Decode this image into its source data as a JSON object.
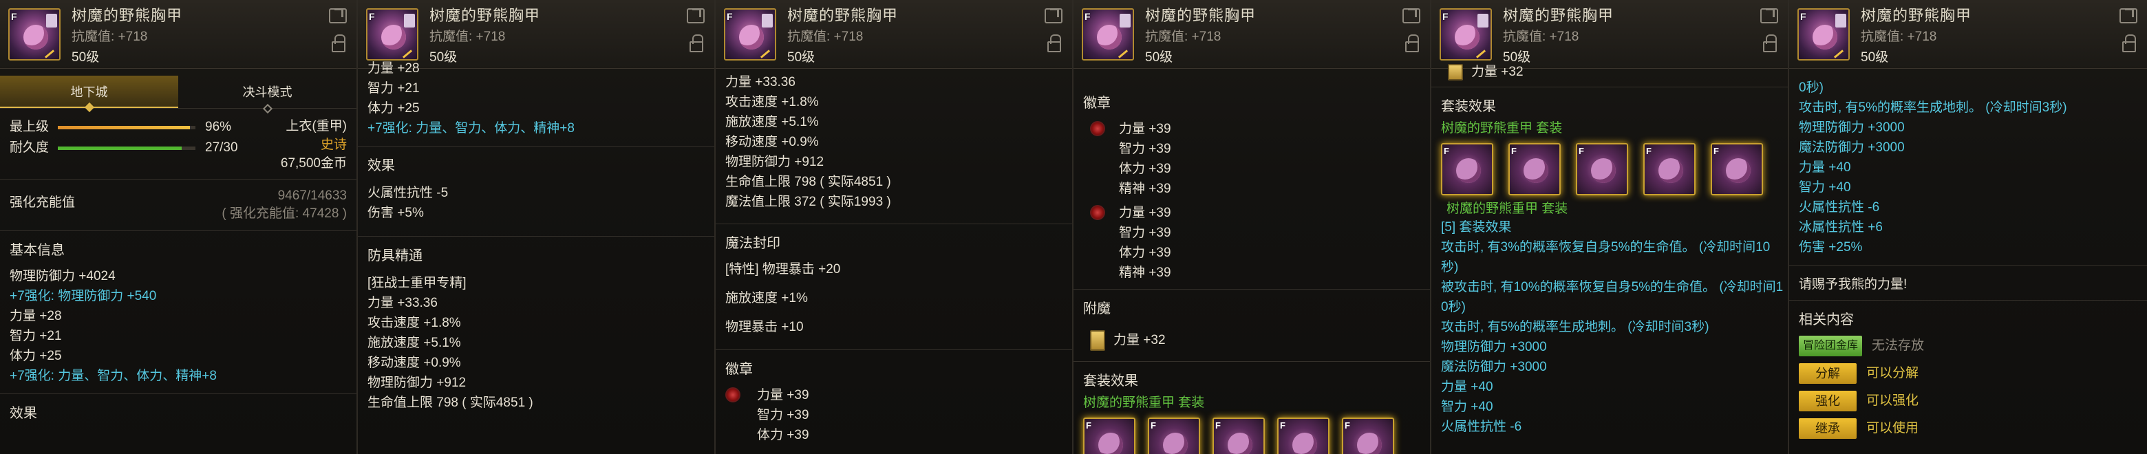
{
  "item": {
    "name": "树魔的野熊胸甲",
    "resist": "抗魔值: +718",
    "level": "50级"
  },
  "p1": {
    "tabs": [
      "地下城",
      "决斗模式"
    ],
    "grade_label": "最上级",
    "grade_pct": "96%",
    "grade_frac": 0.96,
    "dur_label": "耐久度",
    "dur_val": "27/30",
    "dur_frac": 0.9,
    "slot": "上衣(重甲)",
    "rarity": "史诗",
    "price": "67,500金币",
    "charge_title": "强化充能值",
    "charge_val": "9467/14633",
    "charge_detail": "( 强化充能值: 47428 )",
    "basic_title": "基本信息",
    "lines": [
      "物理防御力 +4024",
      "+7强化: 物理防御力 +540",
      "力量 +28",
      "智力 +21",
      "体力 +25",
      "+7强化: 力量、智力、体力、精神+8"
    ],
    "effect_title": "效果"
  },
  "p2": {
    "top": [
      "力量 +28",
      "智力 +21",
      "体力 +25",
      "+7强化: 力量、智力、体力、精神+8"
    ],
    "effect_title": "效果",
    "effects": [
      "火属性抗性 -5",
      "伤害 +5%"
    ],
    "refine_title": "防具精通",
    "refine_sub": "[狂战士重甲专精]",
    "refine": [
      "力量 +33.36",
      "攻击速度 +1.8%",
      "施放速度 +5.1%",
      "移动速度 +0.9%",
      "物理防御力 +912",
      "生命值上限 798 ( 实际4851 )"
    ]
  },
  "p3": {
    "top": [
      "力量 +33.36",
      "攻击速度 +1.8%",
      "施放速度 +5.1%",
      "移动速度 +0.9%",
      "物理防御力 +912",
      "生命值上限 798 ( 实际4851 )",
      "魔法值上限 372 ( 实际1993 )"
    ],
    "seal_title": "魔法封印",
    "seal": [
      "[特性] 物理暴击 +20",
      "施放速度 +1%",
      "物理暴击 +10"
    ],
    "emblem_title": "徽章",
    "emblem": [
      "力量 +39",
      "智力 +39",
      "体力 +39"
    ]
  },
  "p4": {
    "emblem_title": "徽章",
    "emblem1": [
      "力量 +39",
      "智力 +39",
      "体力 +39",
      "精神 +39"
    ],
    "emblem2": [
      "力量 +39",
      "智力 +39",
      "体力 +39",
      "精神 +39"
    ],
    "enchant_title": "附魔",
    "enchant": "力量 +32",
    "set_title": "套装效果",
    "set_name": "树魔的野熊重甲 套装"
  },
  "p5": {
    "top": "力量 +32",
    "set_title": "套装效果",
    "set_name": "树魔的野熊重甲 套装",
    "set_name2": "树魔的野熊重甲 套装",
    "set_count": "[5] 套装效果",
    "lines": [
      "攻击时, 有3%的概率恢复自身5%的生命值。 (冷却时间10",
      "秒)",
      "被攻击时, 有10%的概率恢复自身5%的生命值。 (冷却时间1",
      "0秒)",
      "攻击时, 有5%的概率生成地刺。 (冷却时间3秒)",
      "物理防御力 +3000",
      "魔法防御力 +3000",
      "力量 +40",
      "智力 +40",
      "火属性抗性 -6"
    ]
  },
  "p6": {
    "lines": [
      "0秒)",
      "攻击时, 有5%的概率生成地刺。 (冷却时间3秒)",
      "物理防御力 +3000",
      "魔法防御力 +3000",
      "力量 +40",
      "智力 +40",
      "火属性抗性 -6",
      "冰属性抗性 +6",
      "伤害 +25%"
    ],
    "quote": "请赐予我熊的力量!",
    "related_title": "相关内容",
    "actions": [
      {
        "btn": "冒险团金库",
        "text": "无法存放"
      },
      {
        "btn": "分解",
        "text": "可以分解"
      },
      {
        "btn": "强化",
        "text": "可以强化"
      },
      {
        "btn": "继承",
        "text": "可以使用"
      }
    ]
  },
  "colors": {
    "cyan": "#55c8e0",
    "gold": "#e0b84a",
    "rarity": "#e0a52a"
  }
}
